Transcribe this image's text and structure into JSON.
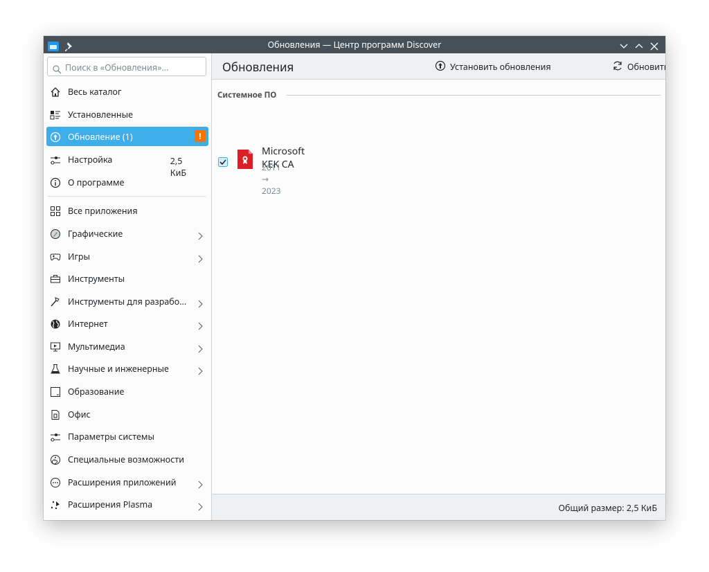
{
  "window": {
    "title": "Обновления — Центр программ Discover"
  },
  "search": {
    "placeholder": "Поиск в «Обновления»..."
  },
  "nav": {
    "top": [
      {
        "label": "Весь каталог",
        "icon": "home-icon"
      },
      {
        "label": "Установленные",
        "icon": "installed-list-icon"
      },
      {
        "label": "Обновление (1)",
        "icon": "update-icon",
        "active": true,
        "badge": "!"
      },
      {
        "label": "Настройка",
        "icon": "settings-sliders-icon"
      },
      {
        "label": "О программе",
        "icon": "info-icon"
      }
    ],
    "categories": [
      {
        "label": "Все приложения",
        "icon": "grid-icon",
        "chevron": false
      },
      {
        "label": "Графические",
        "icon": "graphics-icon",
        "chevron": true
      },
      {
        "label": "Игры",
        "icon": "gamepad-icon",
        "chevron": true
      },
      {
        "label": "Инструменты",
        "icon": "toolbox-icon",
        "chevron": false
      },
      {
        "label": "Инструменты для разрабо...",
        "icon": "hammer-icon",
        "chevron": true
      },
      {
        "label": "Интернет",
        "icon": "globe-icon",
        "chevron": true
      },
      {
        "label": "Мультимедиа",
        "icon": "media-icon",
        "chevron": true
      },
      {
        "label": "Научные и инженерные",
        "icon": "flask-icon",
        "chevron": true
      },
      {
        "label": "Образование",
        "icon": "education-icon",
        "chevron": false
      },
      {
        "label": "Офис",
        "icon": "document-icon",
        "chevron": false
      },
      {
        "label": "Параметры системы",
        "icon": "system-settings-icon",
        "chevron": false
      },
      {
        "label": "Специальные возможности",
        "icon": "accessibility-icon",
        "chevron": false
      },
      {
        "label": "Расширения приложений",
        "icon": "extensions-icon",
        "chevron": true
      },
      {
        "label": "Расширения Plasma",
        "icon": "plasma-icon",
        "chevron": true
      }
    ]
  },
  "main": {
    "title": "Обновления",
    "install_label": "Установить обновления",
    "refresh_label": "Обновить список",
    "section_title": "Системное ПО",
    "updates": [
      {
        "name": "Microsoft KEK CA",
        "version": "2011 → 2023",
        "size": "2,5 КиБ",
        "checked": true
      }
    ],
    "total_size": "Общий размер: 2,5 КиБ"
  },
  "colors": {
    "accent": "#3daee9",
    "badge": "#f67400",
    "titlebar": "#475057"
  }
}
